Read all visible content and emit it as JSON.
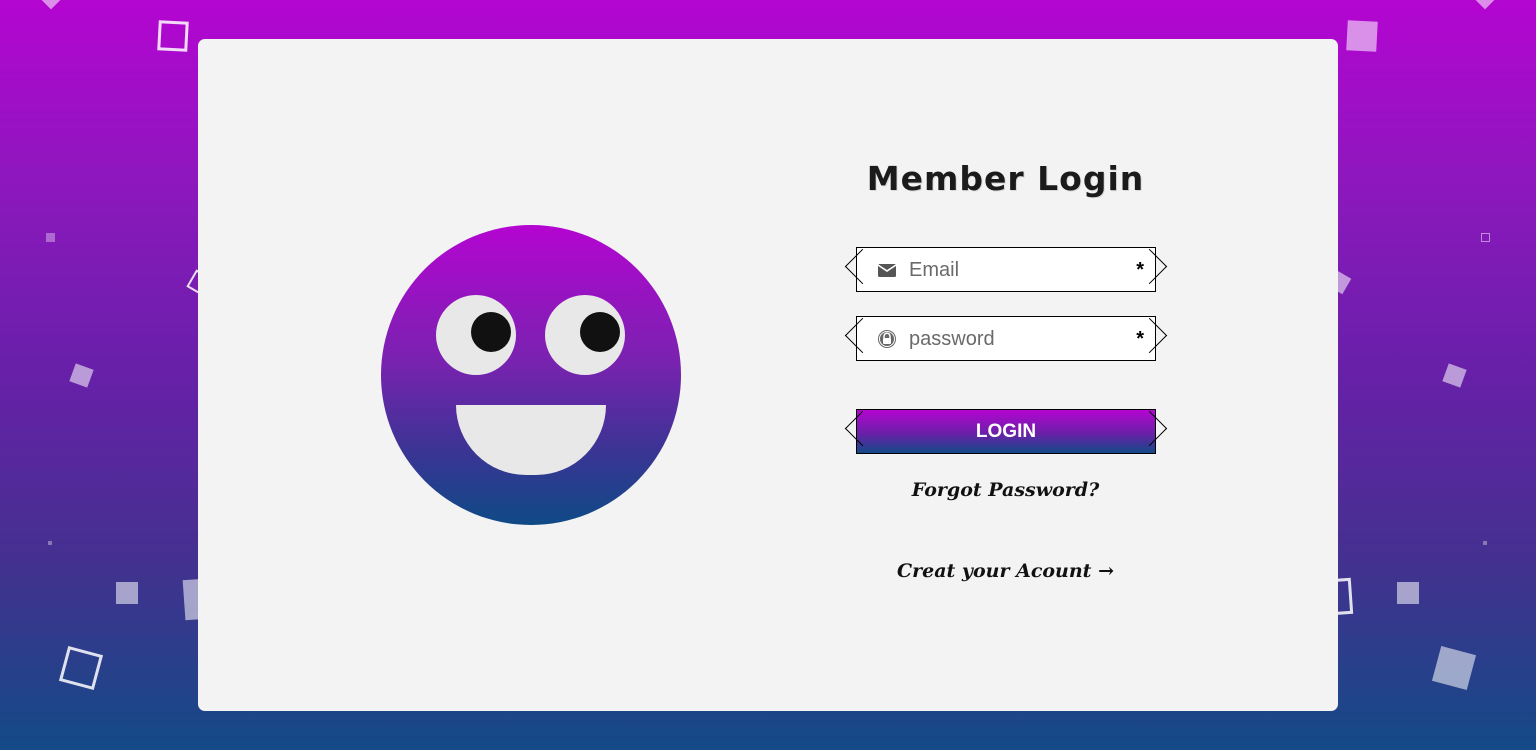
{
  "form": {
    "title": "Member Login",
    "email": {
      "placeholder": "Email",
      "value": "",
      "icon": "envelope-icon",
      "required_mark": "*"
    },
    "password": {
      "placeholder": "password",
      "value": "",
      "icon": "lock-icon",
      "required_mark": "*"
    },
    "login_label": "LOGIN",
    "forgot_label": "Forgot Password?",
    "create_label": "Creat your Acount →"
  },
  "colors": {
    "gradient_top": "#b405d1",
    "gradient_bottom": "#134a87",
    "card_background": "#f3f3f3"
  }
}
